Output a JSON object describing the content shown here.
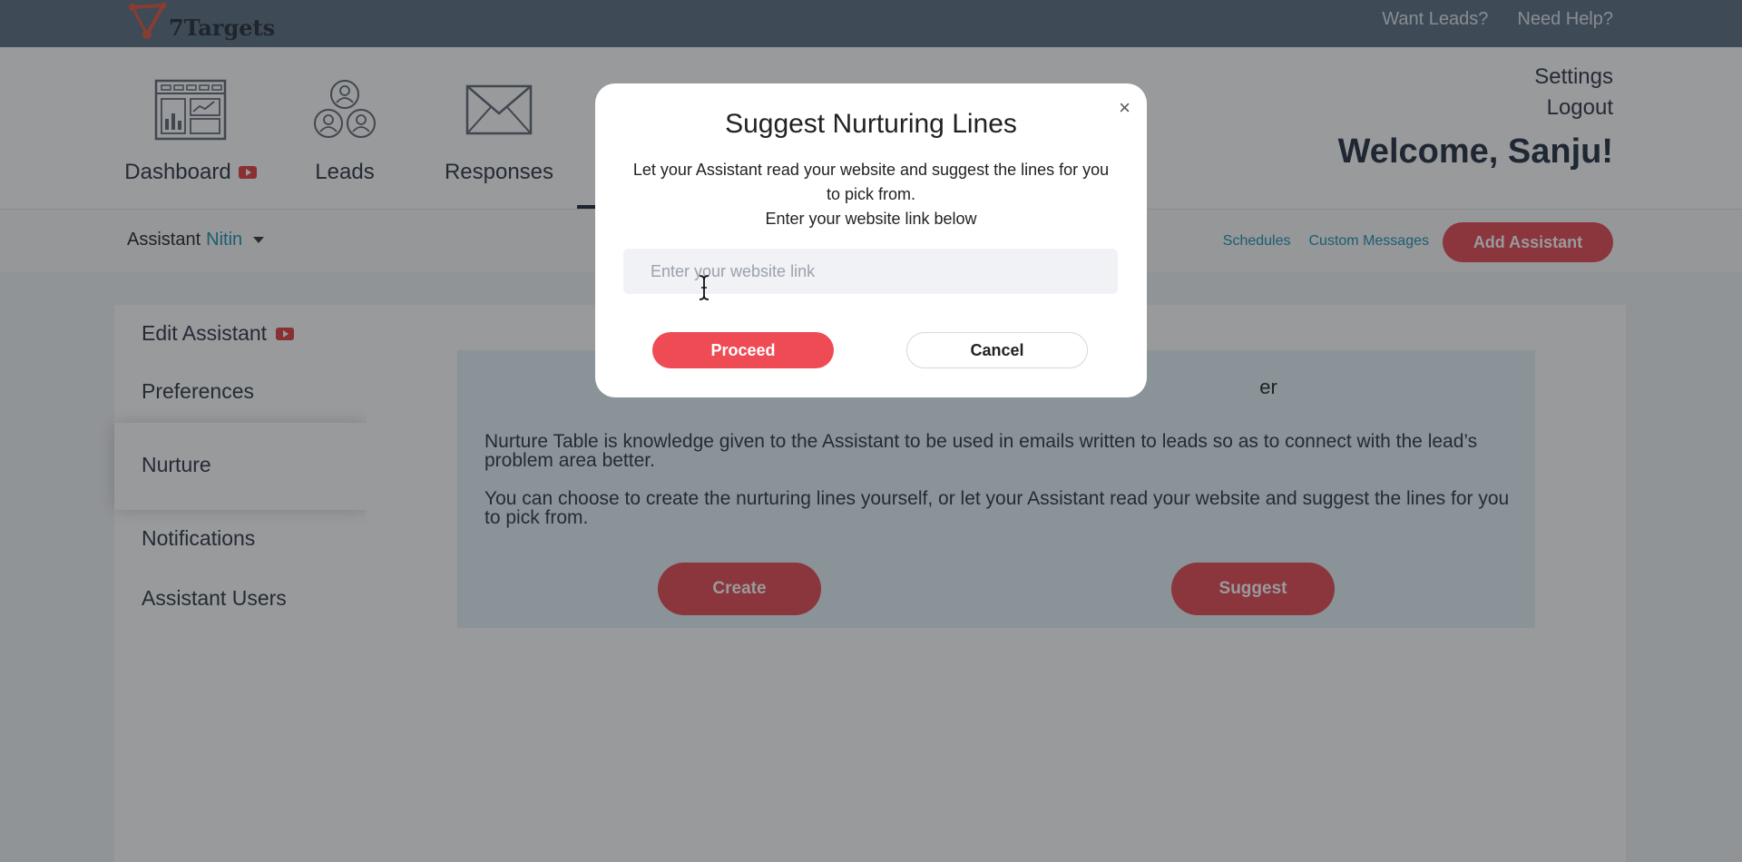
{
  "topbar": {
    "logo_text": "7Targets",
    "links": [
      "Want Leads?",
      "Need Help?"
    ]
  },
  "nav": {
    "items": [
      {
        "label": "Dashboard",
        "icon": "dashboard-icon"
      },
      {
        "label": "Leads",
        "icon": "leads-icon"
      },
      {
        "label": "Responses",
        "icon": "envelope-icon"
      }
    ],
    "settings": "Settings",
    "logout": "Logout",
    "welcome": "Welcome, Sanju!"
  },
  "subbar": {
    "assistant_prefix": "Assistant",
    "assistant_name": "Nitin",
    "schedules": "Schedules",
    "custom_messages": "Custom Messages",
    "add_assistant": "Add Assistant"
  },
  "sidebar": {
    "items": [
      "Edit Assistant",
      "Preferences",
      "Nurture",
      "Notifications",
      "Assistant Users"
    ]
  },
  "nurture": {
    "heading_visible": "er",
    "para1": "Nurture Table is knowledge given to the Assistant to be used in emails written to leads so as to connect with the lead’s problem area better.",
    "para2": "You can choose to create the nurturing lines yourself, or let your Assistant read your website and suggest the lines for you to pick from.",
    "create": "Create",
    "suggest": "Suggest"
  },
  "modal": {
    "title": "Suggest Nurturing Lines",
    "desc_line1": "Let your Assistant read your website and suggest the lines for you to pick from.",
    "desc_line2": "Enter your website link below",
    "input_placeholder": "Enter your website link",
    "input_value": "",
    "proceed": "Proceed",
    "cancel": "Cancel",
    "close": "×"
  },
  "colors": {
    "topbar": "#5a6b7f",
    "accent": "#e8454f",
    "link": "#1a8fae",
    "infobox": "#e6f2f6"
  }
}
